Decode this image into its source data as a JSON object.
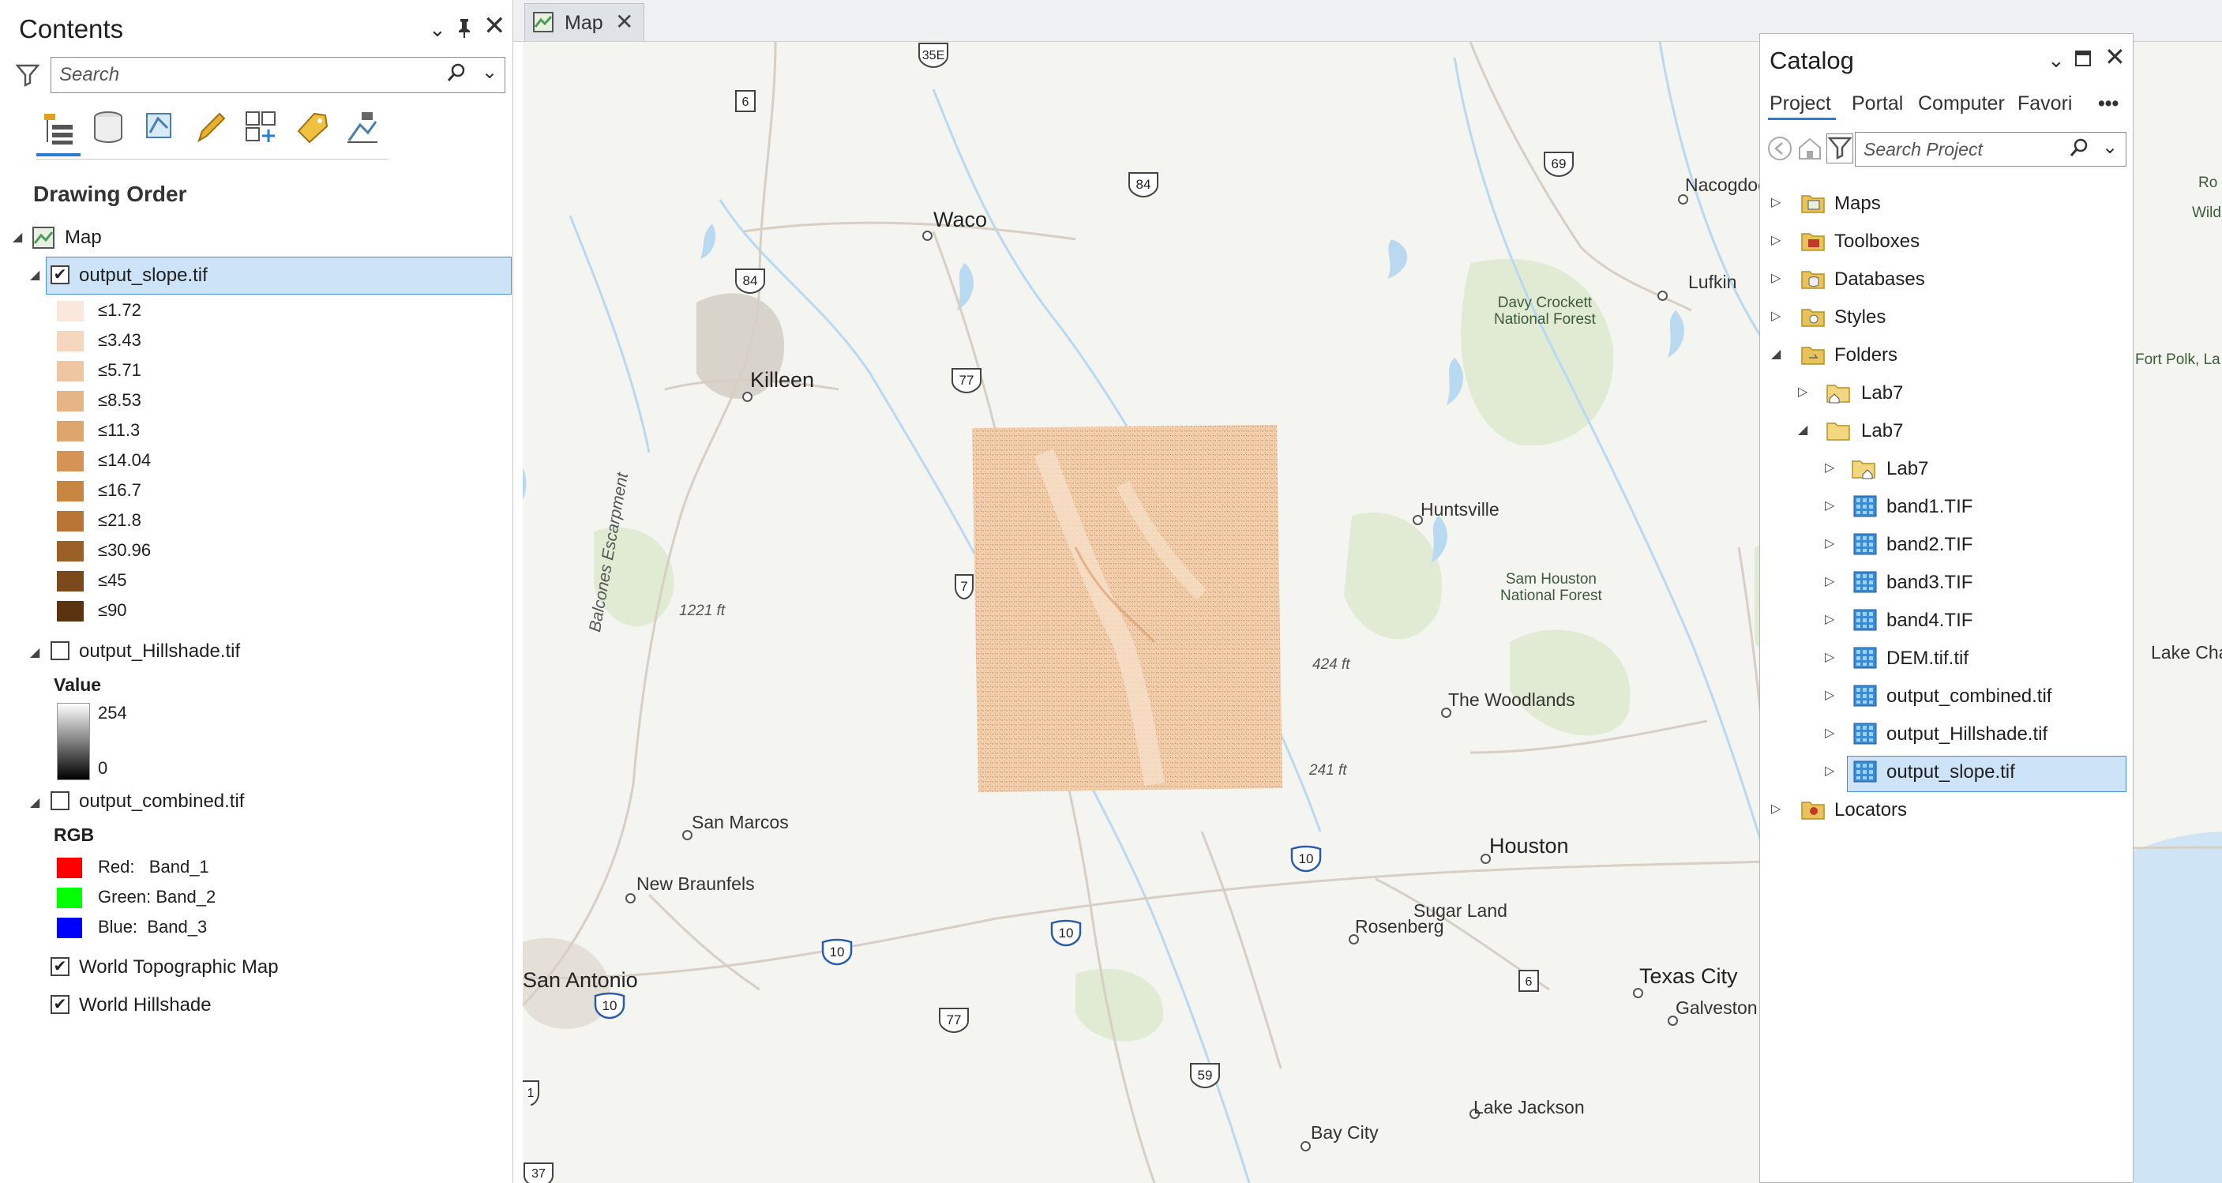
{
  "contents": {
    "title": "Contents",
    "search_placeholder": "Search",
    "section_heading": "Drawing Order",
    "map_node": "Map",
    "layers": {
      "slope": {
        "name": "output_slope.tif",
        "checked": true,
        "classes": [
          {
            "label": "≤1.72",
            "color": "#fbe8dc"
          },
          {
            "label": "≤3.43",
            "color": "#f5d7bd"
          },
          {
            "label": "≤5.71",
            "color": "#eec7a2"
          },
          {
            "label": "≤8.53",
            "color": "#e6b586"
          },
          {
            "label": "≤11.3",
            "color": "#dea56c"
          },
          {
            "label": "≤14.04",
            "color": "#d59455"
          },
          {
            "label": "≤16.7",
            "color": "#c98642"
          },
          {
            "label": "≤21.8",
            "color": "#b87535"
          },
          {
            "label": "≤30.96",
            "color": "#9a6028"
          },
          {
            "label": "≤45",
            "color": "#7a4a1c"
          },
          {
            "label": "≤90",
            "color": "#5a3410"
          }
        ]
      },
      "hillshade": {
        "name": "output_Hillshade.tif",
        "checked": false,
        "legend_title": "Value",
        "max_label": "254",
        "min_label": "0"
      },
      "combined": {
        "name": "output_combined.tif",
        "checked": false,
        "legend_title": "RGB",
        "bands": [
          {
            "label": "Red:   Band_1",
            "color": "#ff0000"
          },
          {
            "label": "Green: Band_2",
            "color": "#00ff00"
          },
          {
            "label": "Blue:  Band_3",
            "color": "#0000ff"
          }
        ]
      },
      "topo": {
        "name": "World Topographic Map",
        "checked": true
      },
      "hillshade_base": {
        "name": "World Hillshade",
        "checked": true
      }
    }
  },
  "map_tab": {
    "label": "Map"
  },
  "map": {
    "cities": {
      "waco": "Waco",
      "killeen": "Killeen",
      "san_marcos": "San Marcos",
      "new_braunfels": "New Braunfels",
      "san_antonio": "San Antonio",
      "huntsville": "Huntsville",
      "the_woodlands": "The Woodlands",
      "houston": "Houston",
      "sugar_land": "Sugar Land",
      "rosenberg": "Rosenberg",
      "texas_city": "Texas City",
      "galveston": "Galveston",
      "lake_jackson": "Lake Jackson",
      "bay_city": "Bay City",
      "lufkin": "Lufkin",
      "nacogdoches": "Nacogdoc",
      "lake_charles": "Lake Cha",
      "fort_polk": "Fort Polk, La",
      "ro": "Ro",
      "wild": "Wildl"
    },
    "parks": {
      "davy_crockett": "Davy Crockett\nNational Forest",
      "sam_houston": "Sam Houston\nNational Forest"
    },
    "escarpment": "Balcones Escarpment",
    "spot_heights": [
      "1221 ft",
      "424 ft",
      "241 ft"
    ],
    "shields": [
      "35E",
      "6",
      "84",
      "84",
      "77",
      "7",
      "69",
      "10",
      "10",
      "10",
      "10",
      "6",
      "77",
      "59",
      "37",
      "1"
    ]
  },
  "catalog": {
    "title": "Catalog",
    "tabs": [
      "Project",
      "Portal",
      "Computer",
      "Favori"
    ],
    "more": "•••",
    "search_placeholder": "Search Project",
    "items": {
      "maps": "Maps",
      "toolboxes": "Toolboxes",
      "databases": "Databases",
      "styles": "Styles",
      "folders": "Folders",
      "lab7_a": "Lab7",
      "lab7_b": "Lab7",
      "lab7_c": "Lab7",
      "band1": "band1.TIF",
      "band2": "band2.TIF",
      "band3": "band3.TIF",
      "band4": "band4.TIF",
      "dem": "DEM.tif.tif",
      "combined": "output_combined.tif",
      "hillshade": "output_Hillshade.tif",
      "slope": "output_slope.tif",
      "locators": "Locators"
    }
  }
}
